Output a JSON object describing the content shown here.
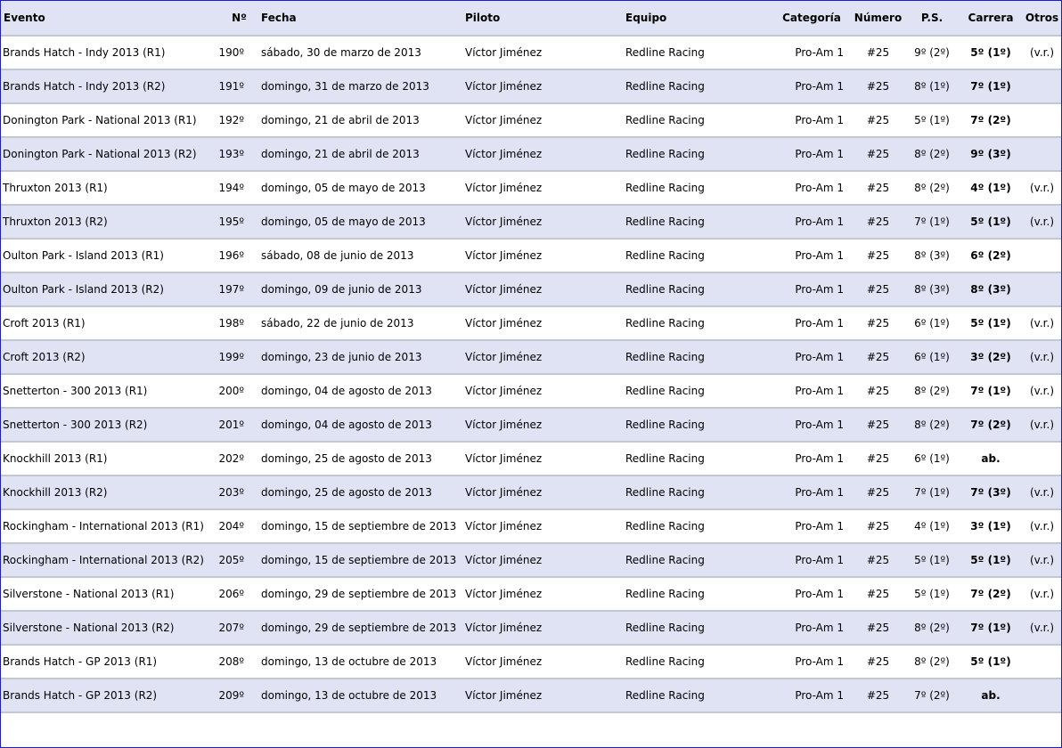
{
  "table": {
    "headers": {
      "evento": "Evento",
      "numero_orden": "Nº",
      "fecha": "Fecha",
      "piloto": "Piloto",
      "equipo": "Equipo",
      "categoria": "Categoría",
      "numero": "Número",
      "ps": "P.S.",
      "carrera": "Carrera",
      "otros": "Otros"
    },
    "rows": [
      {
        "evento": "Brands Hatch - Indy 2013 (R1)",
        "n": "190º",
        "fecha": "sábado, 30 de marzo de 2013",
        "piloto": "Víctor Jiménez",
        "equipo": "Redline Racing",
        "categoria": "Pro-Am 1",
        "numero": "#25",
        "ps": "9º (2º)",
        "carrera": "5º (1º)",
        "otros": "(v.r.)"
      },
      {
        "evento": "Brands Hatch - Indy 2013 (R2)",
        "n": "191º",
        "fecha": "domingo, 31 de marzo de 2013",
        "piloto": "Víctor Jiménez",
        "equipo": "Redline Racing",
        "categoria": "Pro-Am 1",
        "numero": "#25",
        "ps": "8º (1º)",
        "carrera": "7º (1º)",
        "otros": ""
      },
      {
        "evento": "Donington Park - National 2013 (R1)",
        "n": "192º",
        "fecha": "domingo, 21 de abril de 2013",
        "piloto": "Víctor Jiménez",
        "equipo": "Redline Racing",
        "categoria": "Pro-Am 1",
        "numero": "#25",
        "ps": "5º (1º)",
        "carrera": "7º (2º)",
        "otros": ""
      },
      {
        "evento": "Donington Park - National 2013 (R2)",
        "n": "193º",
        "fecha": "domingo, 21 de abril de 2013",
        "piloto": "Víctor Jiménez",
        "equipo": "Redline Racing",
        "categoria": "Pro-Am 1",
        "numero": "#25",
        "ps": "8º (2º)",
        "carrera": "9º (3º)",
        "otros": ""
      },
      {
        "evento": "Thruxton 2013 (R1)",
        "n": "194º",
        "fecha": "domingo, 05 de mayo de 2013",
        "piloto": "Víctor Jiménez",
        "equipo": "Redline Racing",
        "categoria": "Pro-Am 1",
        "numero": "#25",
        "ps": "8º (2º)",
        "carrera": "4º (1º)",
        "otros": "(v.r.)"
      },
      {
        "evento": "Thruxton 2013 (R2)",
        "n": "195º",
        "fecha": "domingo, 05 de mayo de 2013",
        "piloto": "Víctor Jiménez",
        "equipo": "Redline Racing",
        "categoria": "Pro-Am 1",
        "numero": "#25",
        "ps": "7º (1º)",
        "carrera": "5º (1º)",
        "otros": "(v.r.)"
      },
      {
        "evento": "Oulton Park - Island 2013 (R1)",
        "n": "196º",
        "fecha": "sábado, 08 de junio de 2013",
        "piloto": "Víctor Jiménez",
        "equipo": "Redline Racing",
        "categoria": "Pro-Am 1",
        "numero": "#25",
        "ps": "8º (3º)",
        "carrera": "6º (2º)",
        "otros": ""
      },
      {
        "evento": "Oulton Park - Island 2013 (R2)",
        "n": "197º",
        "fecha": "domingo, 09 de junio de 2013",
        "piloto": "Víctor Jiménez",
        "equipo": "Redline Racing",
        "categoria": "Pro-Am 1",
        "numero": "#25",
        "ps": "8º (3º)",
        "carrera": "8º (3º)",
        "otros": ""
      },
      {
        "evento": "Croft 2013 (R1)",
        "n": "198º",
        "fecha": "sábado, 22 de junio de 2013",
        "piloto": "Víctor Jiménez",
        "equipo": "Redline Racing",
        "categoria": "Pro-Am 1",
        "numero": "#25",
        "ps": "6º (1º)",
        "carrera": "5º (1º)",
        "otros": "(v.r.)"
      },
      {
        "evento": "Croft 2013 (R2)",
        "n": "199º",
        "fecha": "domingo, 23 de junio de 2013",
        "piloto": "Víctor Jiménez",
        "equipo": "Redline Racing",
        "categoria": "Pro-Am 1",
        "numero": "#25",
        "ps": "6º (1º)",
        "carrera": "3º (2º)",
        "otros": "(v.r.)"
      },
      {
        "evento": "Snetterton - 300 2013 (R1)",
        "n": "200º",
        "fecha": "domingo, 04 de agosto de 2013",
        "piloto": "Víctor Jiménez",
        "equipo": "Redline Racing",
        "categoria": "Pro-Am 1",
        "numero": "#25",
        "ps": "8º (2º)",
        "carrera": "7º (1º)",
        "otros": "(v.r.)"
      },
      {
        "evento": "Snetterton - 300 2013 (R2)",
        "n": "201º",
        "fecha": "domingo, 04 de agosto de 2013",
        "piloto": "Víctor Jiménez",
        "equipo": "Redline Racing",
        "categoria": "Pro-Am 1",
        "numero": "#25",
        "ps": "8º (2º)",
        "carrera": "7º (2º)",
        "otros": "(v.r.)"
      },
      {
        "evento": "Knockhill 2013 (R1)",
        "n": "202º",
        "fecha": "domingo, 25 de agosto de 2013",
        "piloto": "Víctor Jiménez",
        "equipo": "Redline Racing",
        "categoria": "Pro-Am 1",
        "numero": "#25",
        "ps": "6º (1º)",
        "carrera": "ab.",
        "otros": ""
      },
      {
        "evento": "Knockhill 2013 (R2)",
        "n": "203º",
        "fecha": "domingo, 25 de agosto de 2013",
        "piloto": "Víctor Jiménez",
        "equipo": "Redline Racing",
        "categoria": "Pro-Am 1",
        "numero": "#25",
        "ps": "7º (1º)",
        "carrera": "7º (3º)",
        "otros": "(v.r.)"
      },
      {
        "evento": "Rockingham - International 2013 (R1)",
        "n": "204º",
        "fecha": "domingo, 15 de septiembre de 2013",
        "piloto": "Víctor Jiménez",
        "equipo": "Redline Racing",
        "categoria": "Pro-Am 1",
        "numero": "#25",
        "ps": "4º (1º)",
        "carrera": "3º (1º)",
        "otros": "(v.r.)"
      },
      {
        "evento": "Rockingham - International 2013 (R2)",
        "n": "205º",
        "fecha": "domingo, 15 de septiembre de 2013",
        "piloto": "Víctor Jiménez",
        "equipo": "Redline Racing",
        "categoria": "Pro-Am 1",
        "numero": "#25",
        "ps": "5º (1º)",
        "carrera": "5º (1º)",
        "otros": "(v.r.)"
      },
      {
        "evento": "Silverstone - National 2013 (R1)",
        "n": "206º",
        "fecha": "domingo, 29 de septiembre de 2013",
        "piloto": "Víctor Jiménez",
        "equipo": "Redline Racing",
        "categoria": "Pro-Am 1",
        "numero": "#25",
        "ps": "5º (1º)",
        "carrera": "7º (2º)",
        "otros": "(v.r.)"
      },
      {
        "evento": "Silverstone - National 2013 (R2)",
        "n": "207º",
        "fecha": "domingo, 29 de septiembre de 2013",
        "piloto": "Víctor Jiménez",
        "equipo": "Redline Racing",
        "categoria": "Pro-Am 1",
        "numero": "#25",
        "ps": "8º (2º)",
        "carrera": "7º (1º)",
        "otros": "(v.r.)"
      },
      {
        "evento": "Brands Hatch - GP 2013 (R1)",
        "n": "208º",
        "fecha": "domingo, 13 de octubre de 2013",
        "piloto": "Víctor Jiménez",
        "equipo": "Redline Racing",
        "categoria": "Pro-Am 1",
        "numero": "#25",
        "ps": "8º (2º)",
        "carrera": "5º (1º)",
        "otros": ""
      },
      {
        "evento": "Brands Hatch - GP 2013 (R2)",
        "n": "209º",
        "fecha": "domingo, 13 de octubre de 2013",
        "piloto": "Víctor Jiménez",
        "equipo": "Redline Racing",
        "categoria": "Pro-Am 1",
        "numero": "#25",
        "ps": "7º (2º)",
        "carrera": "ab.",
        "otros": ""
      }
    ]
  }
}
